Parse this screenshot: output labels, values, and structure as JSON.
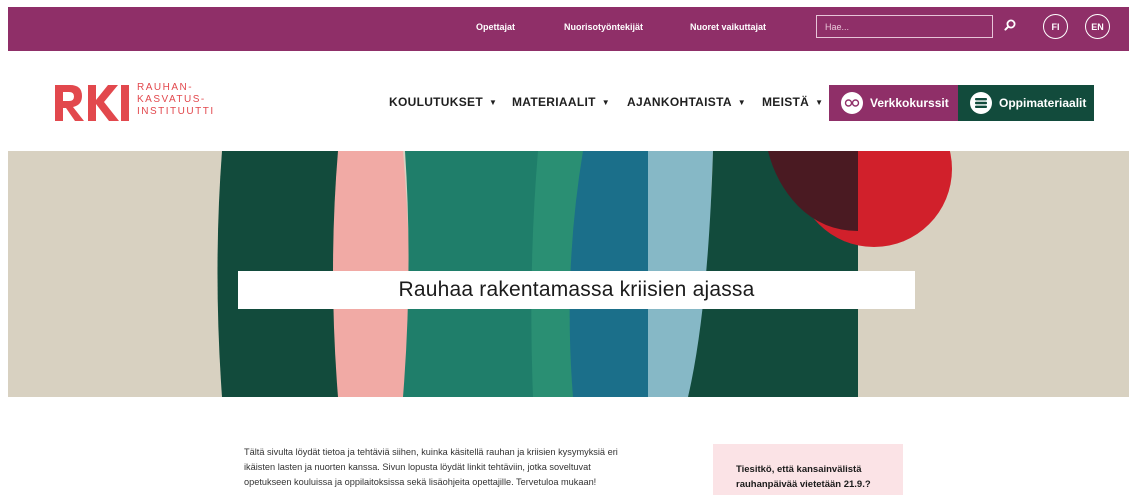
{
  "topbar": {
    "links": [
      "Opettajat",
      "Nuorisotyöntekijät",
      "Nuoret vaikuttajat"
    ],
    "search_placeholder": "Hae...",
    "languages": [
      "FI",
      "EN"
    ]
  },
  "header": {
    "logo": {
      "mark": "RKI",
      "line1": "RAUHAN-",
      "line2": "KASVATUS-",
      "line3": "INSTITUUTTI"
    },
    "nav": [
      "KOULUTUKSET",
      "MATERIAALIT",
      "AJANKOHTAISTA",
      "MEISTÄ"
    ],
    "cta_courses": "Verkkokurssit",
    "cta_materials": "Oppimateriaalit"
  },
  "hero": {
    "title": "Rauhaa rakentamassa kriisien ajassa"
  },
  "content": {
    "intro_line1": "Tältä sivulta löydät tietoa ja tehtäviä siihen, kuinka käsitellä rauhan ja kriisien kysymyksiä eri",
    "intro_line2": "ikäisten lasten ja nuorten kanssa. Sivun lopusta löydät linkit tehtäviin, jotka soveltuvat",
    "intro_line3": "opetukseen kouluissa ja oppilaitoksissa sekä lisäohjeita opettajille. Tervetuloa mukaan!",
    "callout_line1": "Tiesitkö, että kansainvälistä",
    "callout_line2": "rauhanpäivää vietetään 21.9.?"
  },
  "colors": {
    "topbar": "#8f2f68",
    "brand_red": "#e2484d",
    "cta_purple": "#8f2f68",
    "cta_green": "#124b3c",
    "hero_bg": "#d8d1c1"
  },
  "icons": [
    "search-icon",
    "glasses-icon",
    "book-stack-icon",
    "caret-down-icon"
  ]
}
